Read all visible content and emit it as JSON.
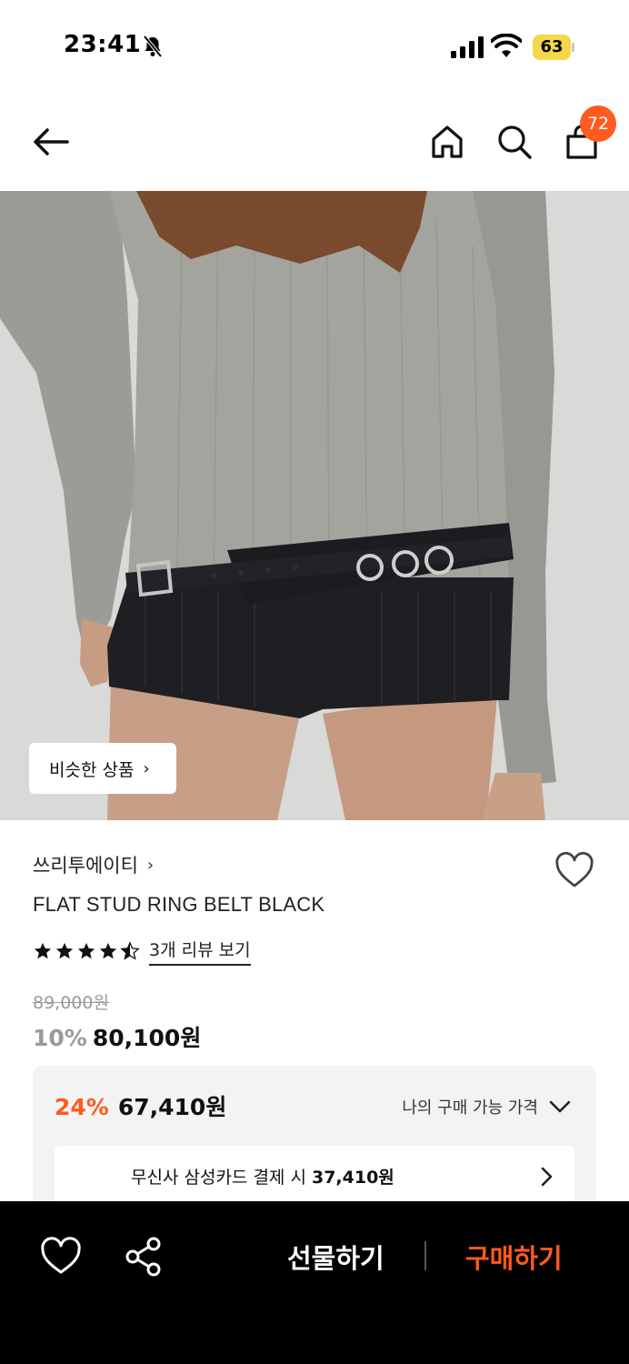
{
  "status_bar": {
    "time": "23:41",
    "battery_level": "63",
    "icons": [
      "bell-slash-icon",
      "signal-icon",
      "wifi-icon",
      "battery-icon"
    ]
  },
  "nav": {
    "icons": [
      "back-arrow-icon",
      "home-icon",
      "search-icon",
      "cart-icon"
    ],
    "cart_count": "72"
  },
  "hero": {
    "similar_button_label": "비슷한 상품"
  },
  "product": {
    "brand": "쓰리투에이티",
    "name": "FLAT STUD RING BELT BLACK",
    "rating": 4.5,
    "review_link": "3개 리뷰 보기",
    "original_price": "89,000원",
    "discount_rate": "10%",
    "sale_price": "80,100원"
  },
  "benefit": {
    "discount_rate": "24%",
    "price": "67,410원",
    "my_price_label": "나의 구매 가능 가격",
    "card_offer_prefix": "무신사 삼성카드 결제 시",
    "card_offer_price": "37,410원"
  },
  "bottom_bar": {
    "gift_label": "선물하기",
    "buy_label": "구매하기",
    "icons": [
      "heart-icon",
      "share-icon"
    ]
  },
  "colors": {
    "accent": "#ff5a1f",
    "battery": "#f5d74a",
    "bottom_bar_bg": "#000000",
    "benefit_bg": "#f3f3f3"
  }
}
